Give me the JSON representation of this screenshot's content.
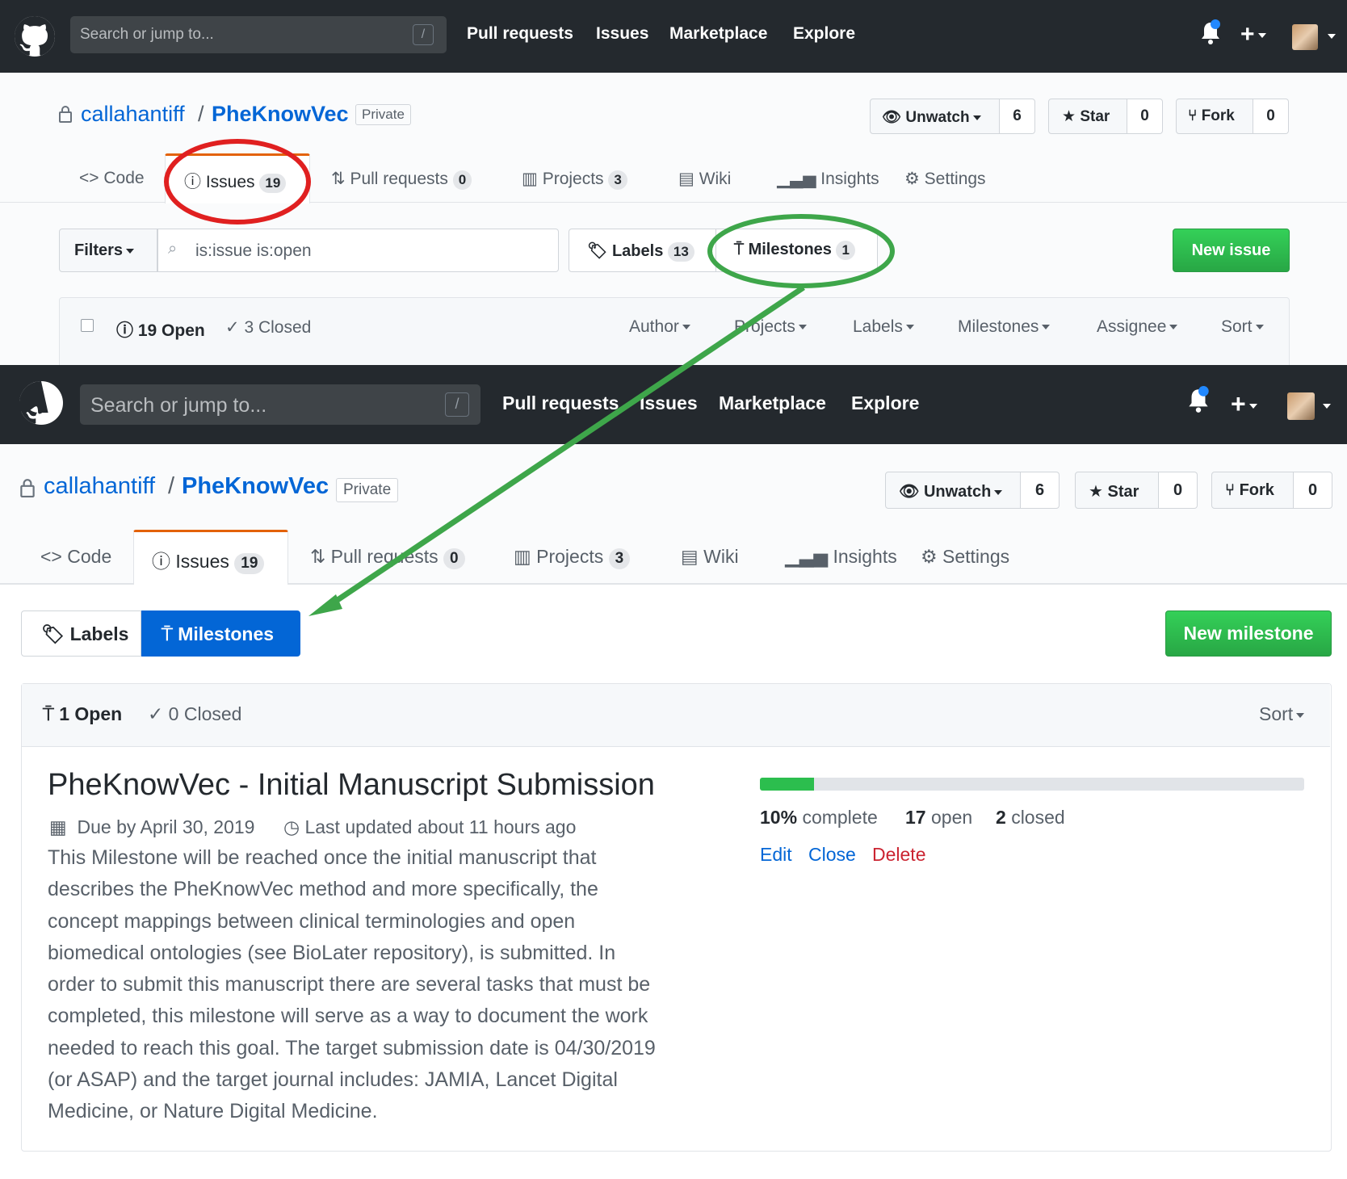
{
  "top": {
    "header": {
      "search_placeholder": "Search or jump to...",
      "slash": "/",
      "nav": [
        "Pull requests",
        "Issues",
        "Marketplace",
        "Explore"
      ]
    },
    "repo": {
      "owner": "callahantiff",
      "sep": "/",
      "name": "PheKnowVec",
      "visibility": "Private"
    },
    "actions": {
      "unwatch": "Unwatch",
      "unwatch_count": "6",
      "star": "Star",
      "star_count": "0",
      "fork": "Fork",
      "fork_count": "0"
    },
    "tabs": {
      "code": "Code",
      "issues": "Issues",
      "issues_count": "19",
      "pulls": "Pull requests",
      "pulls_count": "0",
      "projects": "Projects",
      "projects_count": "3",
      "wiki": "Wiki",
      "insights": "Insights",
      "settings": "Settings"
    },
    "toolbar": {
      "filters": "Filters",
      "query": "is:issue is:open",
      "labels": "Labels",
      "labels_count": "13",
      "milestones": "Milestones",
      "milestones_count": "1",
      "new_issue": "New issue"
    },
    "list_header": {
      "open": "19 Open",
      "closed": "3 Closed",
      "filters": [
        "Author",
        "Projects",
        "Labels",
        "Milestones",
        "Assignee",
        "Sort"
      ]
    }
  },
  "bottom": {
    "header": {
      "search_placeholder": "Search or jump to...",
      "slash": "/",
      "nav": [
        "Pull requests",
        "Issues",
        "Marketplace",
        "Explore"
      ]
    },
    "repo": {
      "owner": "callahantiff",
      "sep": "/",
      "name": "PheKnowVec",
      "visibility": "Private"
    },
    "actions": {
      "unwatch": "Unwatch",
      "unwatch_count": "6",
      "star": "Star",
      "star_count": "0",
      "fork": "Fork",
      "fork_count": "0"
    },
    "tabs": {
      "code": "Code",
      "issues": "Issues",
      "issues_count": "19",
      "pulls": "Pull requests",
      "pulls_count": "0",
      "projects": "Projects",
      "projects_count": "3",
      "wiki": "Wiki",
      "insights": "Insights",
      "settings": "Settings"
    },
    "toolbar": {
      "labels": "Labels",
      "milestones": "Milestones",
      "new_milestone": "New milestone"
    },
    "list_header": {
      "open": "1 Open",
      "closed": "0 Closed",
      "sort": "Sort"
    },
    "milestone": {
      "title": "PheKnowVec - Initial Manuscript Submission",
      "due": "Due by April 30, 2019",
      "updated": "Last updated about 11 hours ago",
      "description": [
        "This Milestone will be reached once the initial manuscript that",
        "describes the PheKnowVec method and more specifically, the",
        "concept mappings between clinical terminologies and open",
        "biomedical ontologies (see BioLater repository), is submitted. In",
        "order to submit this manuscript there are several tasks that must be",
        "completed, this milestone will serve as a way to document the work",
        "needed to reach this goal. The target submission date is 04/30/2019",
        "(or ASAP) and the target journal includes: JAMIA, Lancet Digital",
        "Medicine, or Nature Digital Medicine."
      ],
      "progress_fraction": 0.1,
      "percent": "10%",
      "percent_label": "complete",
      "open_count": "17",
      "open_label": "open",
      "closed_count": "2",
      "closed_label": "closed",
      "edit": "Edit",
      "close": "Close",
      "delete": "Delete"
    }
  },
  "colors": {
    "header_bg": "#24292e",
    "link": "#0366d6",
    "green_button": "#2cbe4e",
    "blue_selected": "#0366d6",
    "annotation_red": "#e02020",
    "annotation_green": "#3ea64a",
    "orange_tab": "#e36209",
    "delete_red": "#cb2431"
  }
}
